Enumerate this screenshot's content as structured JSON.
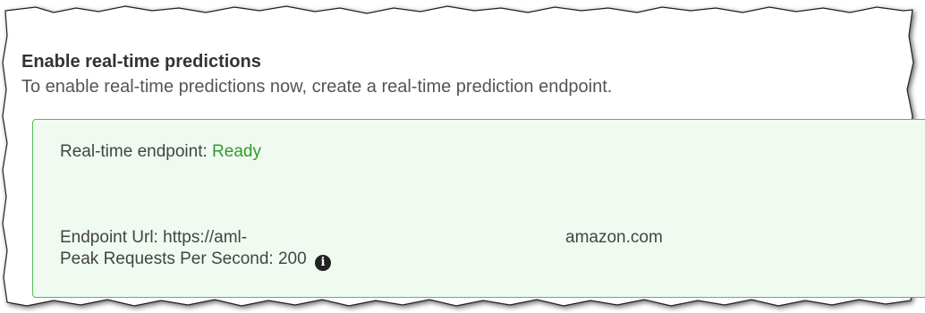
{
  "section": {
    "title": "Enable real-time predictions",
    "description": "To enable real-time predictions now, create a real-time prediction endpoint."
  },
  "endpoint": {
    "status_label": "Real-time endpoint:",
    "status_value": "Ready",
    "status_color": "#2e9c2e",
    "url_label": "Endpoint Url:",
    "url_prefix": "https://aml-",
    "url_suffix": "amazon.com",
    "rps_label": "Peak Requests Per Second:",
    "rps_value": "200",
    "info_icon": "info-circle-icon"
  },
  "colors": {
    "box_border": "#5cb85c",
    "box_background": "#f0faf0"
  }
}
